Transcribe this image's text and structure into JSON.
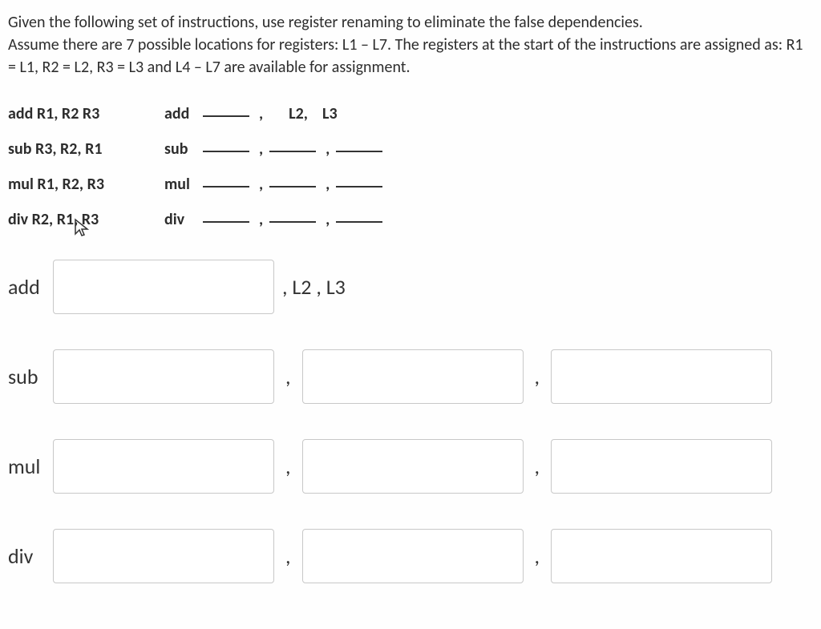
{
  "intro": {
    "line1": "Given the following set of instructions, use register renaming to eliminate the false dependencies.",
    "line2": "Assume there are 7 possible locations for registers: L1 – L7. The registers at the start of the instructions are assigned as: R1 = L1, R2 = L2, R3 = L3 and L4 – L7 are available for assignment."
  },
  "instructions": {
    "row1": {
      "left": "add R1, R2 R3",
      "op": "add",
      "fixed_suffix": "L2,    L3"
    },
    "row2": {
      "left": "sub R3, R2, R1",
      "op": "sub"
    },
    "row3": {
      "left": "mul R1, R2, R3",
      "op": "mul"
    },
    "row4": {
      "left": "div R2, R1, R3",
      "op": "div"
    }
  },
  "answers": {
    "add": {
      "label": "add",
      "suffix": ", L2 , L3"
    },
    "sub": {
      "label": "sub"
    },
    "mul": {
      "label": "mul"
    },
    "div": {
      "label": "div"
    }
  },
  "commas": {
    "c": ","
  }
}
